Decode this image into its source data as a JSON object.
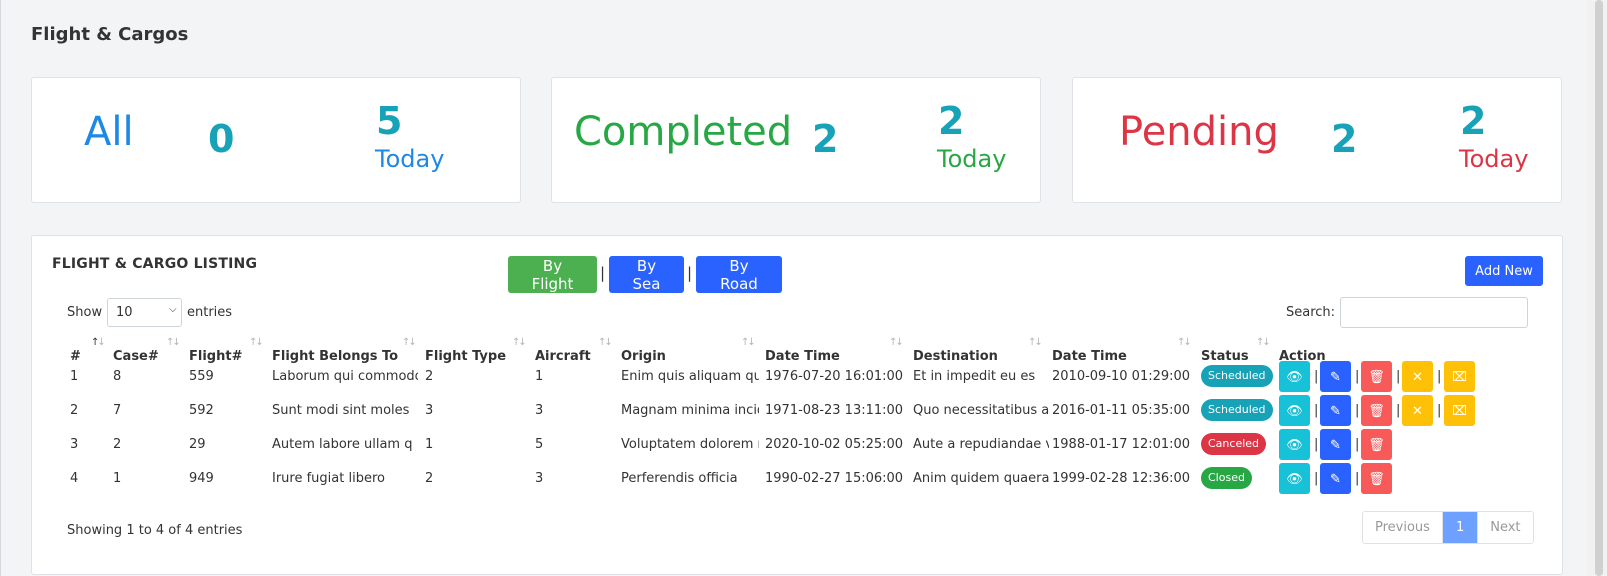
{
  "page_title": "Flight & Cargos",
  "stats": [
    {
      "label": "All",
      "count": "0",
      "today_count": "5",
      "today_label": "Today",
      "color": "#1e88e5"
    },
    {
      "label": "Completed",
      "count": "2",
      "today_count": "2",
      "today_label": "Today",
      "color": "#28a745"
    },
    {
      "label": "Pending",
      "count": "2",
      "today_count": "2",
      "today_label": "Today",
      "color": "#dc3545"
    }
  ],
  "listing": {
    "title": "FLIGHT & CARGO LISTING",
    "filters": [
      "By Flight",
      "By Sea",
      "By Road"
    ],
    "separator": "|",
    "add_new": "Add New",
    "show_label": "Show",
    "entries_value": "10",
    "entries_label": "entries",
    "search_label": "Search:",
    "columns": [
      "#",
      "Case#",
      "Flight#",
      "Flight Belongs To",
      "Flight Type",
      "Aircraft",
      "Origin",
      "Date Time",
      "Destination",
      "Date Time",
      "Status",
      "Action"
    ],
    "rows": [
      {
        "num": "1",
        "case": "8",
        "flight": "559",
        "belongs_to": "Laborum qui commodo",
        "type": "2",
        "aircraft": "1",
        "origin": "Enim quis aliquam qu",
        "origin_dt": "1976-07-20 16:01:00",
        "destination": "Et in impedit eu es",
        "dest_dt": "2010-09-10 01:29:00",
        "status": "Scheduled"
      },
      {
        "num": "2",
        "case": "7",
        "flight": "592",
        "belongs_to": "Sunt modi sint moles",
        "type": "3",
        "aircraft": "3",
        "origin": "Magnam minima incidi",
        "origin_dt": "1971-08-23 13:11:00",
        "destination": "Quo necessitatibus a",
        "dest_dt": "2016-01-11 05:35:00",
        "status": "Scheduled"
      },
      {
        "num": "3",
        "case": "2",
        "flight": "29",
        "belongs_to": "Autem labore ullam q",
        "type": "1",
        "aircraft": "5",
        "origin": "Voluptatem dolorem r",
        "origin_dt": "2020-10-02 05:25:00",
        "destination": "Aute a repudiandae v",
        "dest_dt": "1988-01-17 12:01:00",
        "status": "Canceled"
      },
      {
        "num": "4",
        "case": "1",
        "flight": "949",
        "belongs_to": "Irure fugiat libero",
        "type": "2",
        "aircraft": "3",
        "origin": "Perferendis officia",
        "origin_dt": "1990-02-27 15:06:00",
        "destination": "Anim quidem quaerat",
        "dest_dt": "1999-02-28 12:36:00",
        "status": "Closed"
      }
    ],
    "showing": "Showing 1 to 4 of 4 entries",
    "pagination": {
      "previous": "Previous",
      "current": "1",
      "next": "Next"
    }
  }
}
